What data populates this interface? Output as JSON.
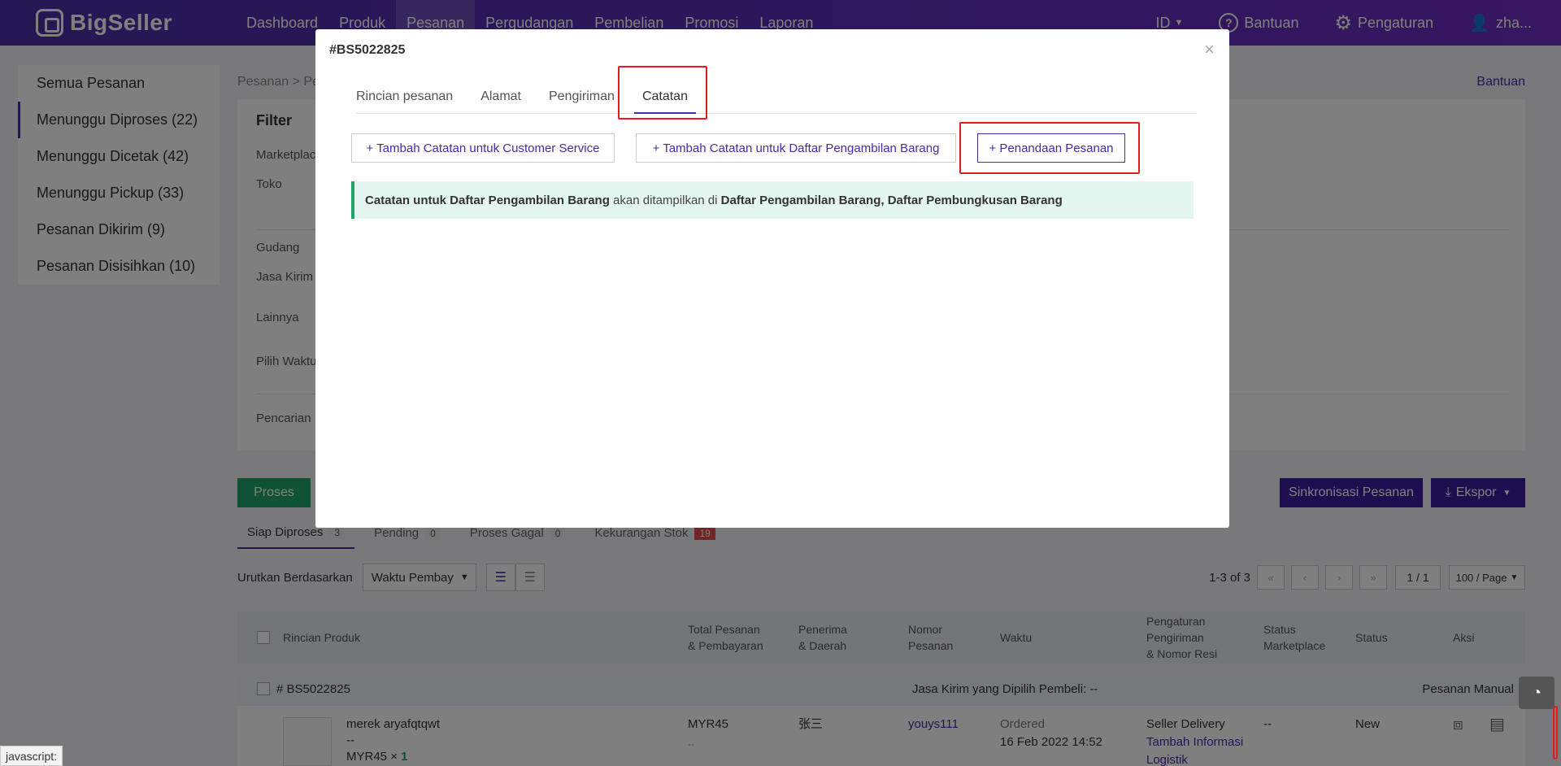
{
  "nav": {
    "logo": "BigSeller",
    "items": [
      "Dashboard",
      "Produk",
      "Pesanan",
      "Pergudangan",
      "Pembelian",
      "Promosi",
      "Laporan"
    ],
    "lang": "ID",
    "help": "Bantuan",
    "settings": "Pengaturan",
    "user": "zha..."
  },
  "sidebar": {
    "items": [
      "Semua Pesanan",
      "Menunggu Diproses (22)",
      "Menunggu Dicetak (42)",
      "Menunggu Pickup (33)",
      "Pesanan Dikirim (9)",
      "Pesanan Disisihkan (10)"
    ]
  },
  "main": {
    "breadcrumb": "Pesanan > Pe",
    "help_link": "Bantuan",
    "filter_title": "Filter",
    "filter_labels": [
      "Marketplace",
      "Toko",
      "Gudang",
      "Jasa Kirim",
      "Lainnya",
      "Pilih Waktu",
      "Pencarian"
    ],
    "process_btn": "Proses",
    "sync_btn": "Sinkronisasi Pesanan",
    "export_btn": "Ekspor",
    "subtabs": [
      {
        "label": "Siap Diproses",
        "count": "3"
      },
      {
        "label": "Pending",
        "count": "0"
      },
      {
        "label": "Proses Gagal",
        "count": "0"
      },
      {
        "label": "Kekurangan Stok",
        "count": "19"
      }
    ],
    "sort_label": "Urutkan Berdasarkan",
    "sort_value": "Waktu Pembay",
    "pager_info": "1-3 of 3",
    "pager_page": "1 / 1",
    "pager_size": "100 / Page",
    "columns": {
      "product": "Rincian Produk",
      "total": "Total Pesanan\n& Pembayaran",
      "receiver": "Penerima\n& Daerah",
      "order_no": "Nomor\nPesanan",
      "time": "Waktu",
      "shipping": "Pengaturan\nPengiriman\n& Nomor Resi",
      "mp_status": "Status\nMarketplace",
      "status": "Status",
      "action": "Aksi"
    },
    "order": {
      "id": "# BS5022825",
      "courier": "Jasa Kirim yang Dipilih Pembeli: --",
      "type": "Pesanan Manual",
      "product_name": "merek aryafqtqwt",
      "product_dash": "--",
      "product_price": "MYR45",
      "product_qty_sep": "×",
      "product_qty": "1",
      "total": "MYR45",
      "total_sub": "--",
      "receiver": "张三",
      "order_no": "youys111",
      "time_label": "Ordered",
      "time_value": "16 Feb 2022 14:52",
      "ship": "Seller Delivery",
      "ship_link": "Tambah Informasi Logistik",
      "mp_status": "--",
      "status": "New"
    }
  },
  "modal": {
    "title": "#BS5022825",
    "tabs": [
      "Rincian pesanan",
      "Alamat",
      "Pengiriman",
      "Catatan"
    ],
    "btn_cs": "+ Tambah Catatan untuk Customer Service",
    "btn_picklist": "+ Tambah Catatan untuk Daftar Pengambilan Barang",
    "btn_mark": "+ Penandaan Pesanan",
    "notice_b1": "Catatan untuk Daftar Pengambilan Barang",
    "notice_mid": " akan ditampilkan di ",
    "notice_b2": "Daftar Pengambilan Barang, Daftar Pembungkusan Barang"
  },
  "status_bar": "javascript:",
  "colors": {
    "primary": "#4b2aa8",
    "green": "#1fa56a",
    "highlight": "#e51c1c"
  }
}
